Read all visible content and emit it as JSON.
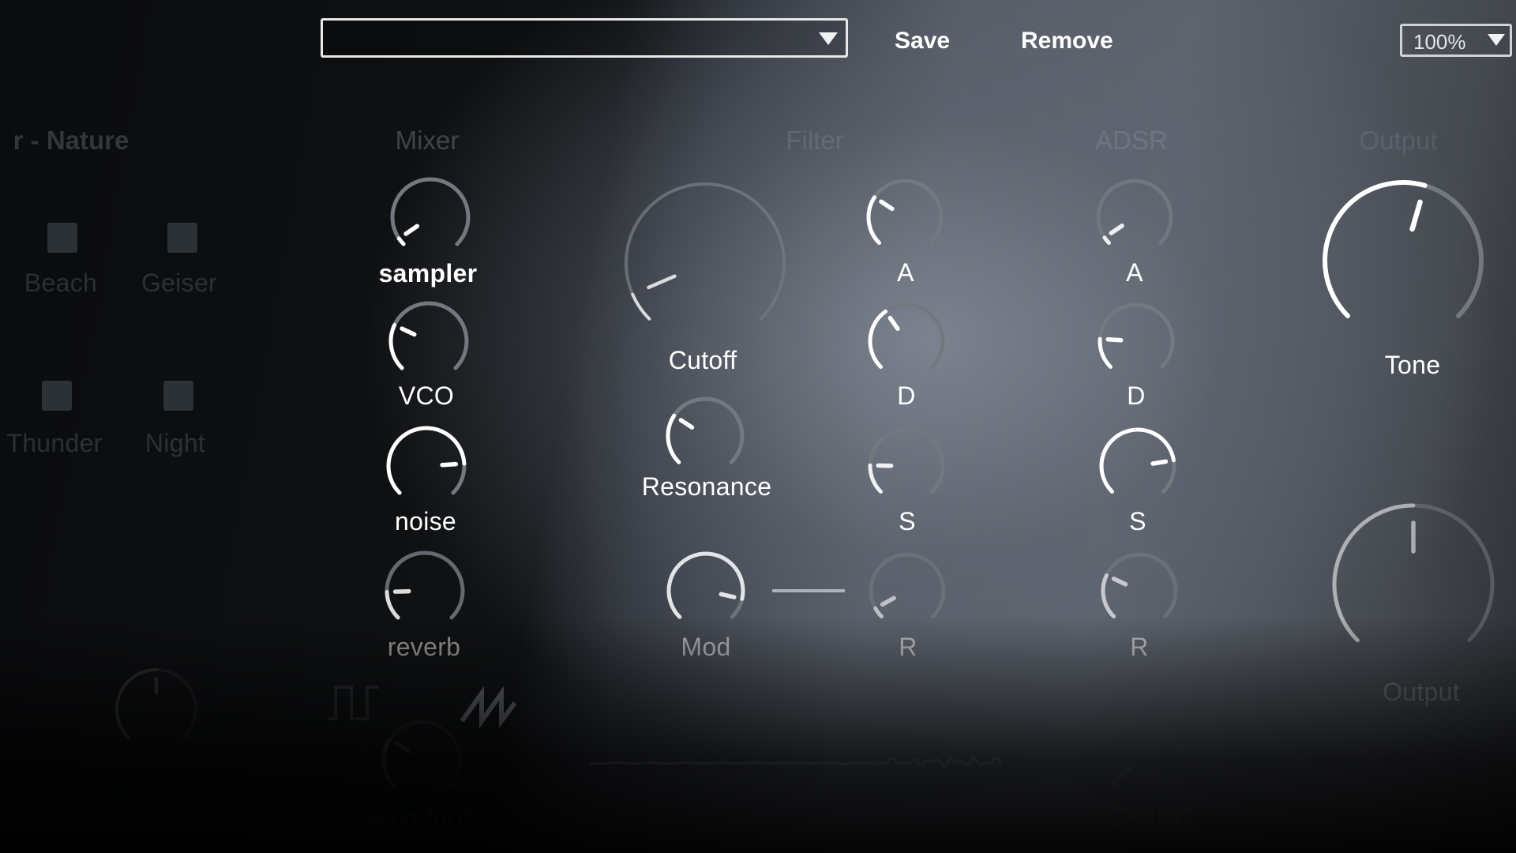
{
  "header": {
    "preset_value": "",
    "save_label": "Save",
    "remove_label": "Remove",
    "zoom_value": "100%"
  },
  "sections": {
    "nature": "r - Nature",
    "mixer": "Mixer",
    "filter": "Filter",
    "adsr": "ADSR",
    "output": "Output"
  },
  "nature": {
    "pads": [
      {
        "label": "Beach"
      },
      {
        "label": "Geiser"
      },
      {
        "label": "Thunder"
      },
      {
        "label": "Night"
      }
    ]
  },
  "mixer": {
    "knobs": [
      {
        "label": "sampler",
        "value": 0.04
      },
      {
        "label": "VCO",
        "value": 0.26
      },
      {
        "label": "noise",
        "value": 0.82
      },
      {
        "label": "reverb",
        "value": 0.16
      }
    ]
  },
  "filter": {
    "cutoff": {
      "label": "Cutoff",
      "value": 0.08
    },
    "resonance": {
      "label": "Resonance",
      "value": 0.29
    },
    "mod": {
      "label": "Mod",
      "value": 0.88
    },
    "env": [
      {
        "label": "A",
        "value": 0.29
      },
      {
        "label": "D",
        "value": 0.37
      },
      {
        "label": "S",
        "value": 0.17
      },
      {
        "label": "R",
        "value": 0.06
      }
    ]
  },
  "adsr": {
    "env": [
      {
        "label": "A",
        "value": 0.04
      },
      {
        "label": "D",
        "value": 0.18
      },
      {
        "label": "S",
        "value": 0.8
      },
      {
        "label": "R",
        "value": 0.26
      }
    ]
  },
  "output": {
    "tone": {
      "label": "Tone",
      "value": 0.56
    },
    "output": {
      "label": "Output",
      "value": 0.5
    }
  },
  "lower": {
    "waveform_label": "waveform",
    "vca_init_label": "VCA INIT"
  },
  "colors": {
    "knob_arc": "#ffffff",
    "knob_track": "#74787f",
    "text": "#ffffff",
    "accent_border": "#e8e8e8"
  },
  "icons": {
    "preset_arrow": "triangle-down-icon",
    "zoom_arrow": "triangle-down-icon",
    "waveforms": [
      "square-wave-icon",
      "sawtooth-wave-icon"
    ]
  }
}
